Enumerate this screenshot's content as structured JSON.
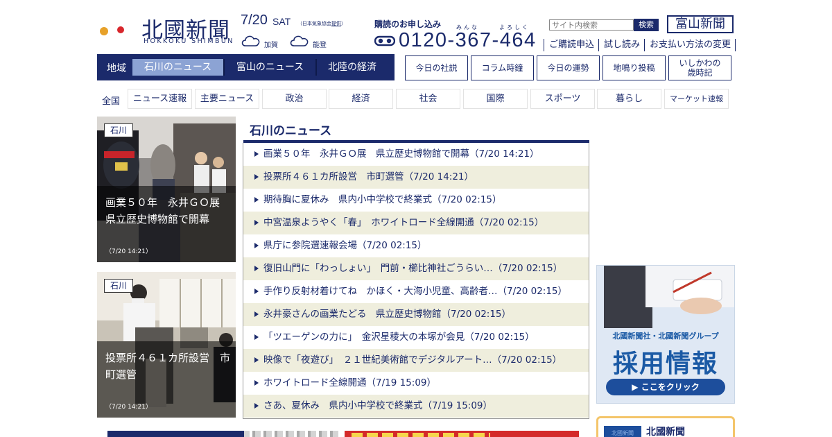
{
  "header": {
    "logo_jp": "北國新聞",
    "logo_en": "HOKKOKU SHIMBUN",
    "date": "7/20",
    "weekday": "SAT",
    "weather_credit_prefix": "（日本気象協会",
    "weather_credit_link": "提供",
    "weather_credit_suffix": "）",
    "weather": [
      {
        "area": "加賀",
        "icon": "cloud-icon"
      },
      {
        "area": "能登",
        "icon": "cloud-icon"
      }
    ],
    "subscribe_label": "購読のお申し込み",
    "ruby_minna": "みんな",
    "ruby_yoroshiku": "よろしく",
    "phone": "0120-367-464",
    "search_placeholder": "サイト内検索",
    "search_button": "検索",
    "toyama_logo": "富山新聞",
    "links": [
      "ご購読申込",
      "試し読み",
      "お支払い方法の変更"
    ]
  },
  "region_nav": {
    "label": "地域",
    "tabs": [
      "石川のニュース",
      "富山のニュース",
      "北陸の経済"
    ],
    "active_index": 0
  },
  "feature_buttons": [
    "今日の社説",
    "コラム時鐘",
    "今日の運勢",
    "地鳴り投稿",
    "いしかわの",
    "歳時記"
  ],
  "categories": {
    "label": "全国",
    "items": [
      "ニュース速報",
      "主要ニュース",
      "政治",
      "経済",
      "社会",
      "国際",
      "スポーツ",
      "暮らし",
      "マーケット速報"
    ]
  },
  "cards": [
    {
      "tag": "石川",
      "title": "画業５０年　永井ＧＯ展　県立歴史博物館で開幕",
      "time": "（7/20 14:21）"
    },
    {
      "tag": "石川",
      "title": "投票所４６１カ所設営　市町選管",
      "time": "（7/20 14:21）"
    }
  ],
  "news": {
    "heading": "石川のニュース",
    "items": [
      "画業５０年　永井ＧＯ展　県立歴史博物館で開幕（7/20 14:21）",
      "投票所４６１カ所設営　市町選管（7/20 14:21）",
      "期待胸に夏休み　県内小中学校で終業式（7/20 02:15）",
      "中宮温泉ようやく「春」　ホワイトロード全線開通（7/20 02:15）",
      "県庁に参院選速報会場（7/20 02:15）",
      "復旧山門に「わっしょい」　門前・櫛比神社ごうらい…（7/20 02:15）",
      "手作り反射材着けてね　かほく・大海小児童、高齢者…（7/20 02:15）",
      "永井豪さんの画業たどる　県立歴史博物館（7/20 02:15）",
      "「ツエーゲンの力に」　金沢星稜大の本塚が会見（7/20 02:15）",
      "映像で「夜遊び」　２１世紀美術館でデジタルアート…（7/20 02:15）",
      "ホワイトロード全線開通（7/19 15:09）",
      "さあ、夏休み　県内小中学校で終業式（7/19 15:09）"
    ]
  },
  "ads": {
    "recruit_line1": "北國新聞社・北國新聞グループ",
    "recruit_big": "採用情報",
    "recruit_button": "▶ ここをクリック",
    "hokkoku_mini": "北國新聞",
    "hokkoku_name": "北國新聞"
  },
  "colors": {
    "brand_navy": "#1b2a6b",
    "active_tab": "#8ca3d4",
    "zebra_row": "#efeedd",
    "recruit_blue": "#1b5aa5",
    "ad_border": "#f4c56a"
  }
}
